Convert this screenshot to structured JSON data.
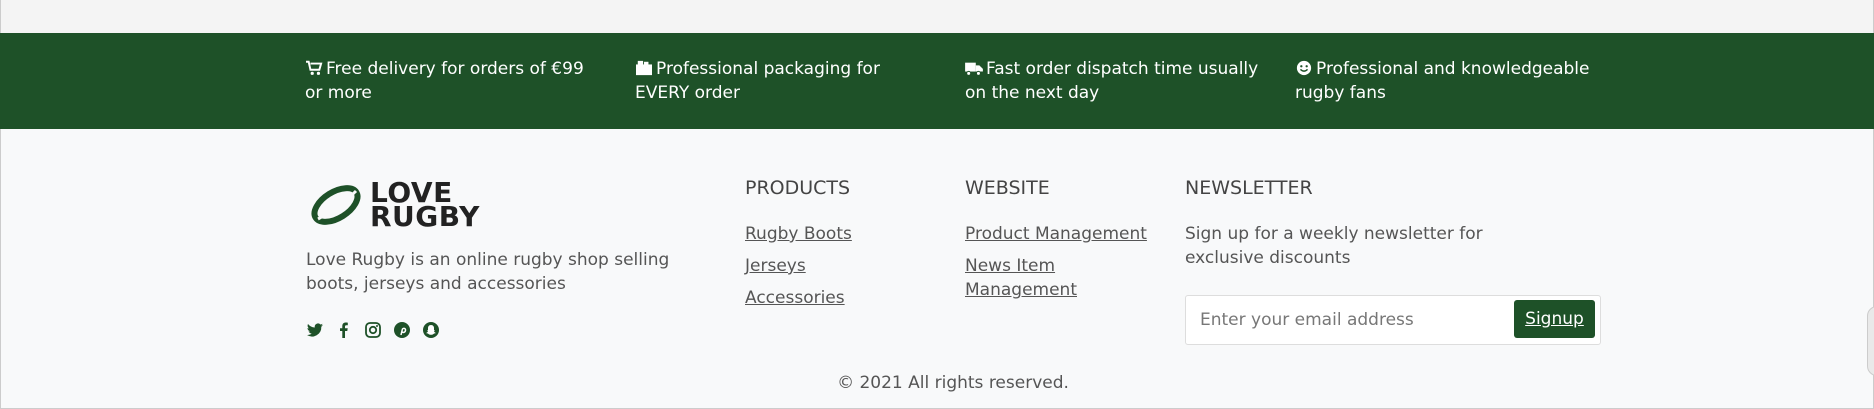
{
  "features": [
    {
      "icon": "cart-icon",
      "text": "Free delivery for orders of €99 or more"
    },
    {
      "icon": "box-icon",
      "text": "Professional packaging for EVERY order"
    },
    {
      "icon": "truck-icon",
      "text": "Fast order dispatch time usually on the next day"
    },
    {
      "icon": "smile-icon",
      "text": "Professional and knowledgeable rugby fans"
    }
  ],
  "brand": {
    "logo_line1": "LOVE",
    "logo_line2": "RUGBY",
    "about": "Love Rugby is an online rugby shop selling boots, jerseys and accessories",
    "accent": "#1e5128"
  },
  "socials": [
    "twitter-icon",
    "facebook-icon",
    "instagram-icon",
    "pinterest-icon",
    "snapchat-icon"
  ],
  "products": {
    "heading": "PRODUCTS",
    "links": [
      "Rugby Boots",
      "Jerseys",
      "Accessories"
    ]
  },
  "website": {
    "heading": "WEBSITE",
    "links": [
      "Product Management",
      "News Item Management"
    ]
  },
  "newsletter": {
    "heading": "NEWSLETTER",
    "text": "Sign up for a weekly newsletter for exclusive discounts",
    "placeholder": "Enter your email address",
    "button": "Signup"
  },
  "copyright": "© 2021 All rights reserved."
}
